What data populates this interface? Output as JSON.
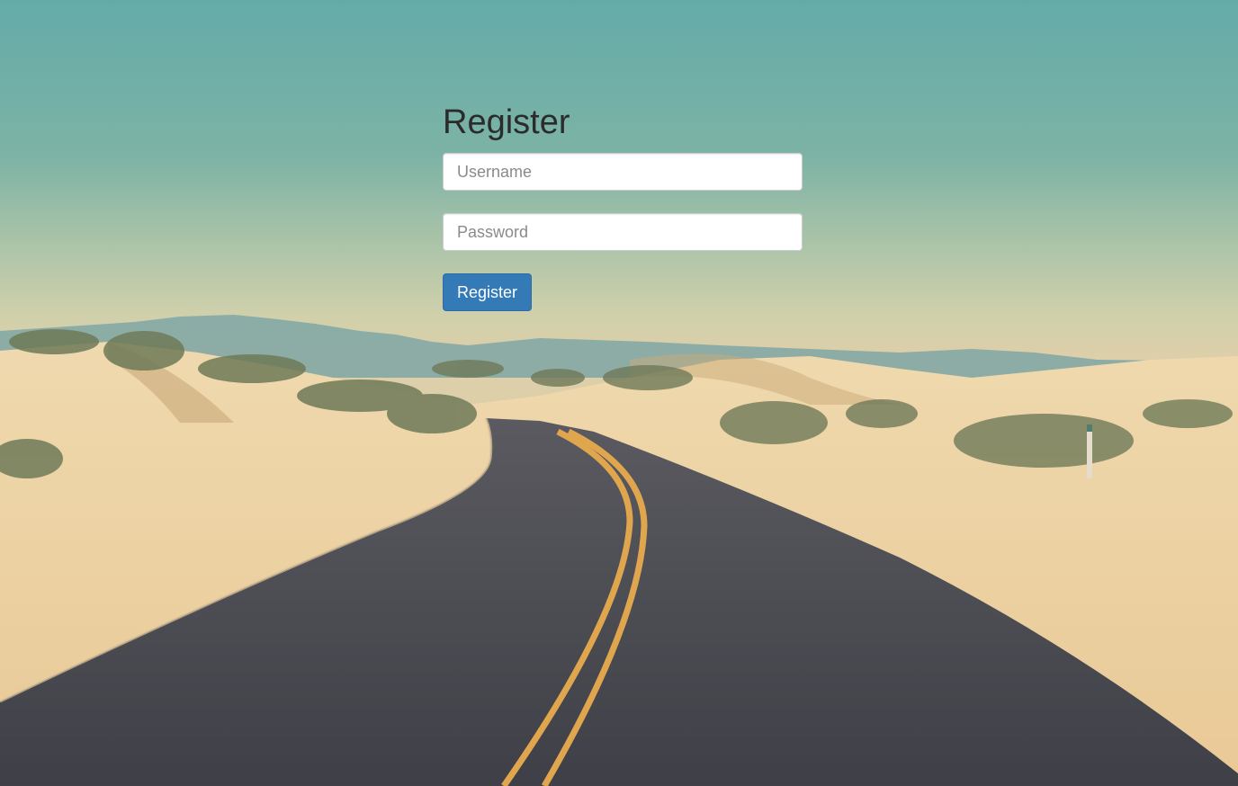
{
  "register_form": {
    "title": "Register",
    "username_placeholder": "Username",
    "password_placeholder": "Password",
    "submit_label": "Register",
    "accent_color": "#337ab7"
  },
  "background": {
    "description_colors": {
      "sky_top": "#64aba8",
      "sand": "#e3cfa5",
      "road": "#4a4a52",
      "road_line": "#e0a64e"
    }
  }
}
